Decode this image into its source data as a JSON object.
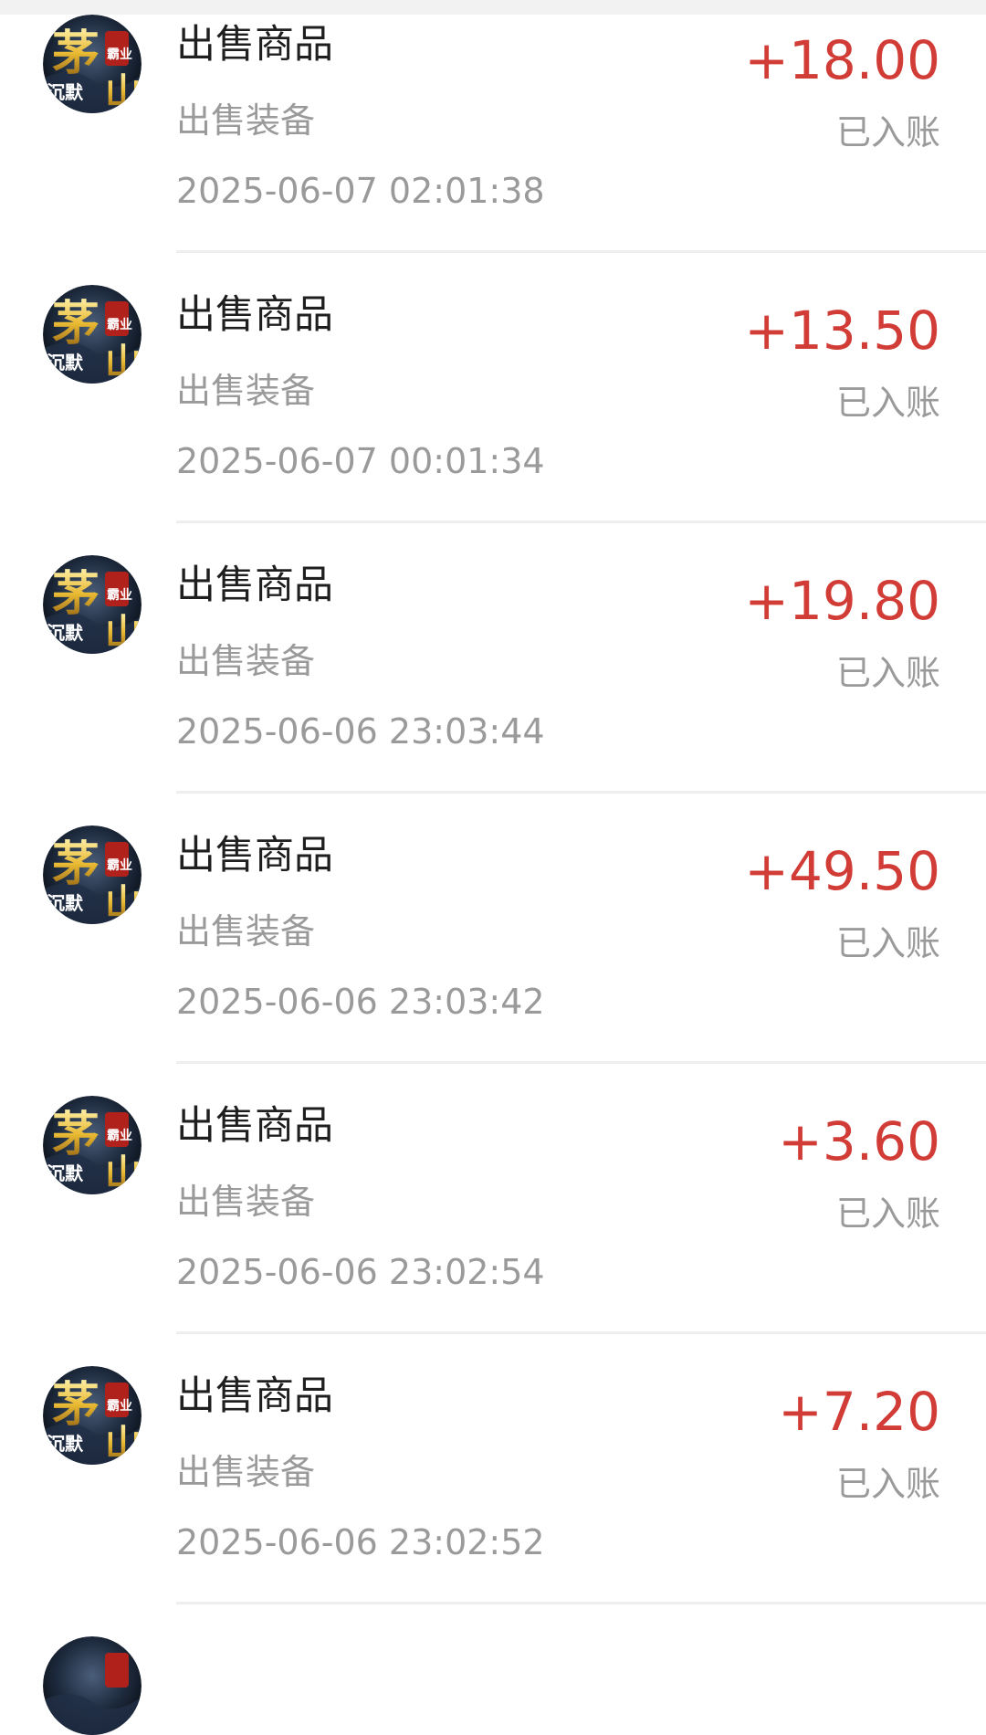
{
  "transactions": [
    {
      "title": "出售商品",
      "subtitle": "出售装备",
      "time": "2025-06-07 02:01:38",
      "amount": "+18.00",
      "status": "已入账"
    },
    {
      "title": "出售商品",
      "subtitle": "出售装备",
      "time": "2025-06-07 00:01:34",
      "amount": "+13.50",
      "status": "已入账"
    },
    {
      "title": "出售商品",
      "subtitle": "出售装备",
      "time": "2025-06-06 23:03:44",
      "amount": "+19.80",
      "status": "已入账"
    },
    {
      "title": "出售商品",
      "subtitle": "出售装备",
      "time": "2025-06-06 23:03:42",
      "amount": "+49.50",
      "status": "已入账"
    },
    {
      "title": "出售商品",
      "subtitle": "出售装备",
      "time": "2025-06-06 23:02:54",
      "amount": "+3.60",
      "status": "已入账"
    },
    {
      "title": "出售商品",
      "subtitle": "出售装备",
      "time": "2025-06-06 23:02:52",
      "amount": "+7.20",
      "status": "已入账"
    }
  ],
  "avatar_logo_text": [
    "茅",
    "山",
    "霸业",
    "沉默"
  ],
  "colors": {
    "amount": "#d23c36",
    "title": "#1f1f1f",
    "secondary": "#9a9a9a",
    "divider": "#eeeeee"
  }
}
